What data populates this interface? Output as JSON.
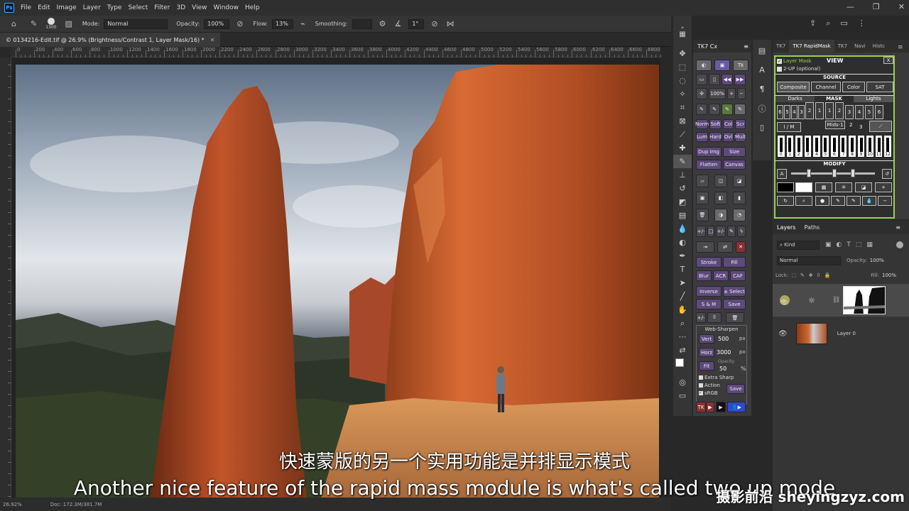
{
  "menubar": {
    "app_icon": "Ps",
    "items": [
      "File",
      "Edit",
      "Image",
      "Layer",
      "Type",
      "Select",
      "Filter",
      "3D",
      "View",
      "Window",
      "Help"
    ]
  },
  "options": {
    "brush_size": "1300",
    "mode_label": "Mode:",
    "mode_value": "Normal",
    "opacity_label": "Opacity:",
    "opacity_value": "100%",
    "flow_label": "Flow:",
    "flow_value": "13%",
    "smoothing_label": "Smoothing:",
    "angle_value": "1°"
  },
  "document": {
    "tab_title": "© 0134216-Edit.tif @ 26.9% (Brightness/Contrast 1, Layer Mask/16) *",
    "ruler_labels": [
      "0",
      "200",
      "400",
      "600",
      "800",
      "1000",
      "1200",
      "1400",
      "1600",
      "1800",
      "2000",
      "2200",
      "2400",
      "2600",
      "2800",
      "3000",
      "3200",
      "3400",
      "3600",
      "3800",
      "4000",
      "4200",
      "4400",
      "4600",
      "4800",
      "5000",
      "5200",
      "5400",
      "5600",
      "5800",
      "6000",
      "6200",
      "6400",
      "6600",
      "6800"
    ],
    "zoom": "26.92%",
    "doc_info": "Doc: 172.3M/381.7M"
  },
  "tk7cx": {
    "title": "TK7 Cx",
    "buttons": {
      "norm": "Norm",
      "soft": "Soft",
      "col": "Col",
      "scr": "Scr",
      "lum": "Lum",
      "hard": "Hard",
      "ovl": "Ovl",
      "mult": "Mult",
      "dup": "Dup Img",
      "size": "Size",
      "flatten": "Flatten",
      "canvas": "Canvas",
      "stroke": "Stroke",
      "fill": "Fill",
      "blur": "Blur",
      "acr": "ACR",
      "caf": "CAF",
      "inverse": "Inverse",
      "select": "± Select",
      "sm": "S & M",
      "save": "Save",
      "plus_minus": "+/-",
      "websharpen": "Web-Sharpen",
      "vert": "Vert",
      "vert_val": "500",
      "horz": "Horz",
      "horz_val": "3000",
      "px": "px",
      "fit": "Fit",
      "opacity_lbl": "Opacity",
      "opacity_val": "50",
      "pct": "%",
      "extra_sharp": "Extra Sharp",
      "action": "Action",
      "srgb": "sRGB",
      "save2": "Save",
      "tk": "TK"
    },
    "hundred": "100%"
  },
  "rapidmask": {
    "tabs": [
      "TK7",
      "TK7 RapidMask",
      "TK7",
      "Navi",
      "Histc"
    ],
    "layer_mask": "Layer Mask",
    "view": "VIEW",
    "close": "X",
    "two_up": "2-UP (optional)",
    "source": "SOURCE",
    "source_btns": [
      "Composite",
      "Channel",
      "Color",
      "SAT"
    ],
    "darks": "Darks",
    "mask": "MASK",
    "lights": "Lights",
    "darks_nums": [
      "6",
      "5",
      "4",
      "3",
      "2"
    ],
    "mid_nums": [
      "1",
      "1"
    ],
    "lights_nums": [
      "2",
      "3",
      "4",
      "5",
      "6"
    ],
    "im": "I / M",
    "mids": "Mids-1",
    "mids_nums": [
      "2",
      "3"
    ],
    "zone_nums": [
      "0",
      "1",
      "2",
      "3",
      "4",
      "5",
      "6",
      "7",
      "8",
      "9",
      "10",
      "11",
      "12"
    ],
    "modify": "MODIFY",
    "a": "A"
  },
  "layers": {
    "tabs": [
      "Layers",
      "Paths"
    ],
    "kind": "Kind",
    "blend": "Normal",
    "opacity_label": "Opacity:",
    "opacity": "100%",
    "lock_label": "Lock:",
    "fill_label": "Fill:",
    "fill": "100%",
    "layer0": "Layer 0"
  },
  "subtitles": {
    "chinese": "快速蒙版的另一个实用功能是并排显示模式",
    "english": "Another nice feature of the rapid mass module is what's called two up mode"
  },
  "watermark": "摄影前沿 sheyingzyz.com"
}
